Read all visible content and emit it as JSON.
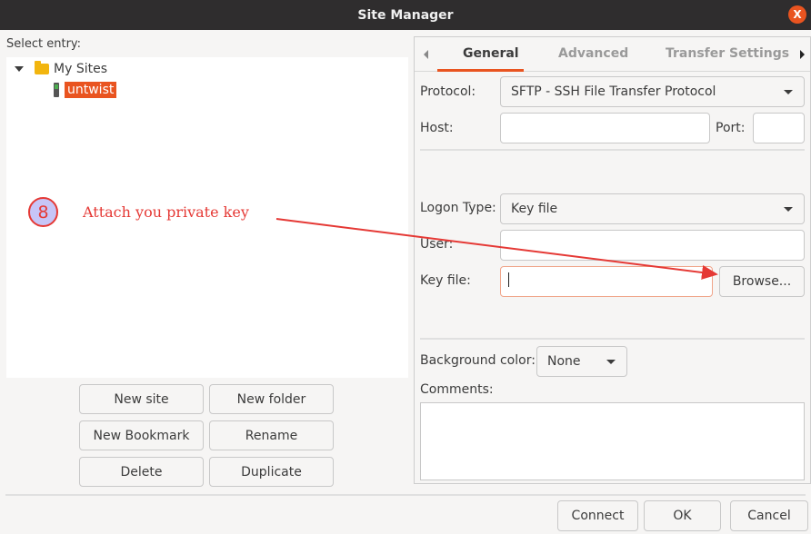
{
  "window": {
    "title": "Site Manager",
    "close_label": "X"
  },
  "tree": {
    "select_label": "Select entry:",
    "folder_label": "My Sites",
    "site_label": "untwist"
  },
  "left_buttons": {
    "new_site": "New site",
    "new_folder": "New folder",
    "new_bookmark": "New Bookmark",
    "rename": "Rename",
    "delete": "Delete",
    "duplicate": "Duplicate"
  },
  "tabs": [
    {
      "label": "General",
      "active": true
    },
    {
      "label": "Advanced",
      "active": false
    },
    {
      "label": "Transfer Settings",
      "active": false
    }
  ],
  "general": {
    "protocol_label": "Protocol:",
    "protocol_value": "SFTP - SSH File Transfer Protocol",
    "host_label": "Host:",
    "host_value": "",
    "port_label": "Port:",
    "port_value": "",
    "logon_type_label": "Logon Type:",
    "logon_type_value": "Key file",
    "user_label": "User:",
    "user_value": "",
    "key_file_label": "Key file:",
    "key_file_value": "",
    "browse_label": "Browse...",
    "bg_color_label": "Background color:",
    "bg_color_value": "None",
    "comments_label": "Comments:",
    "comments_value": ""
  },
  "footer": {
    "connect": "Connect",
    "ok": "OK",
    "cancel": "Cancel"
  },
  "annotation": {
    "step_number": "8",
    "text": "Attach you private key",
    "color": "#e53935"
  },
  "colors": {
    "accent": "#e95420",
    "titlebar": "#2f2d2e",
    "folder": "#f2b50f"
  }
}
